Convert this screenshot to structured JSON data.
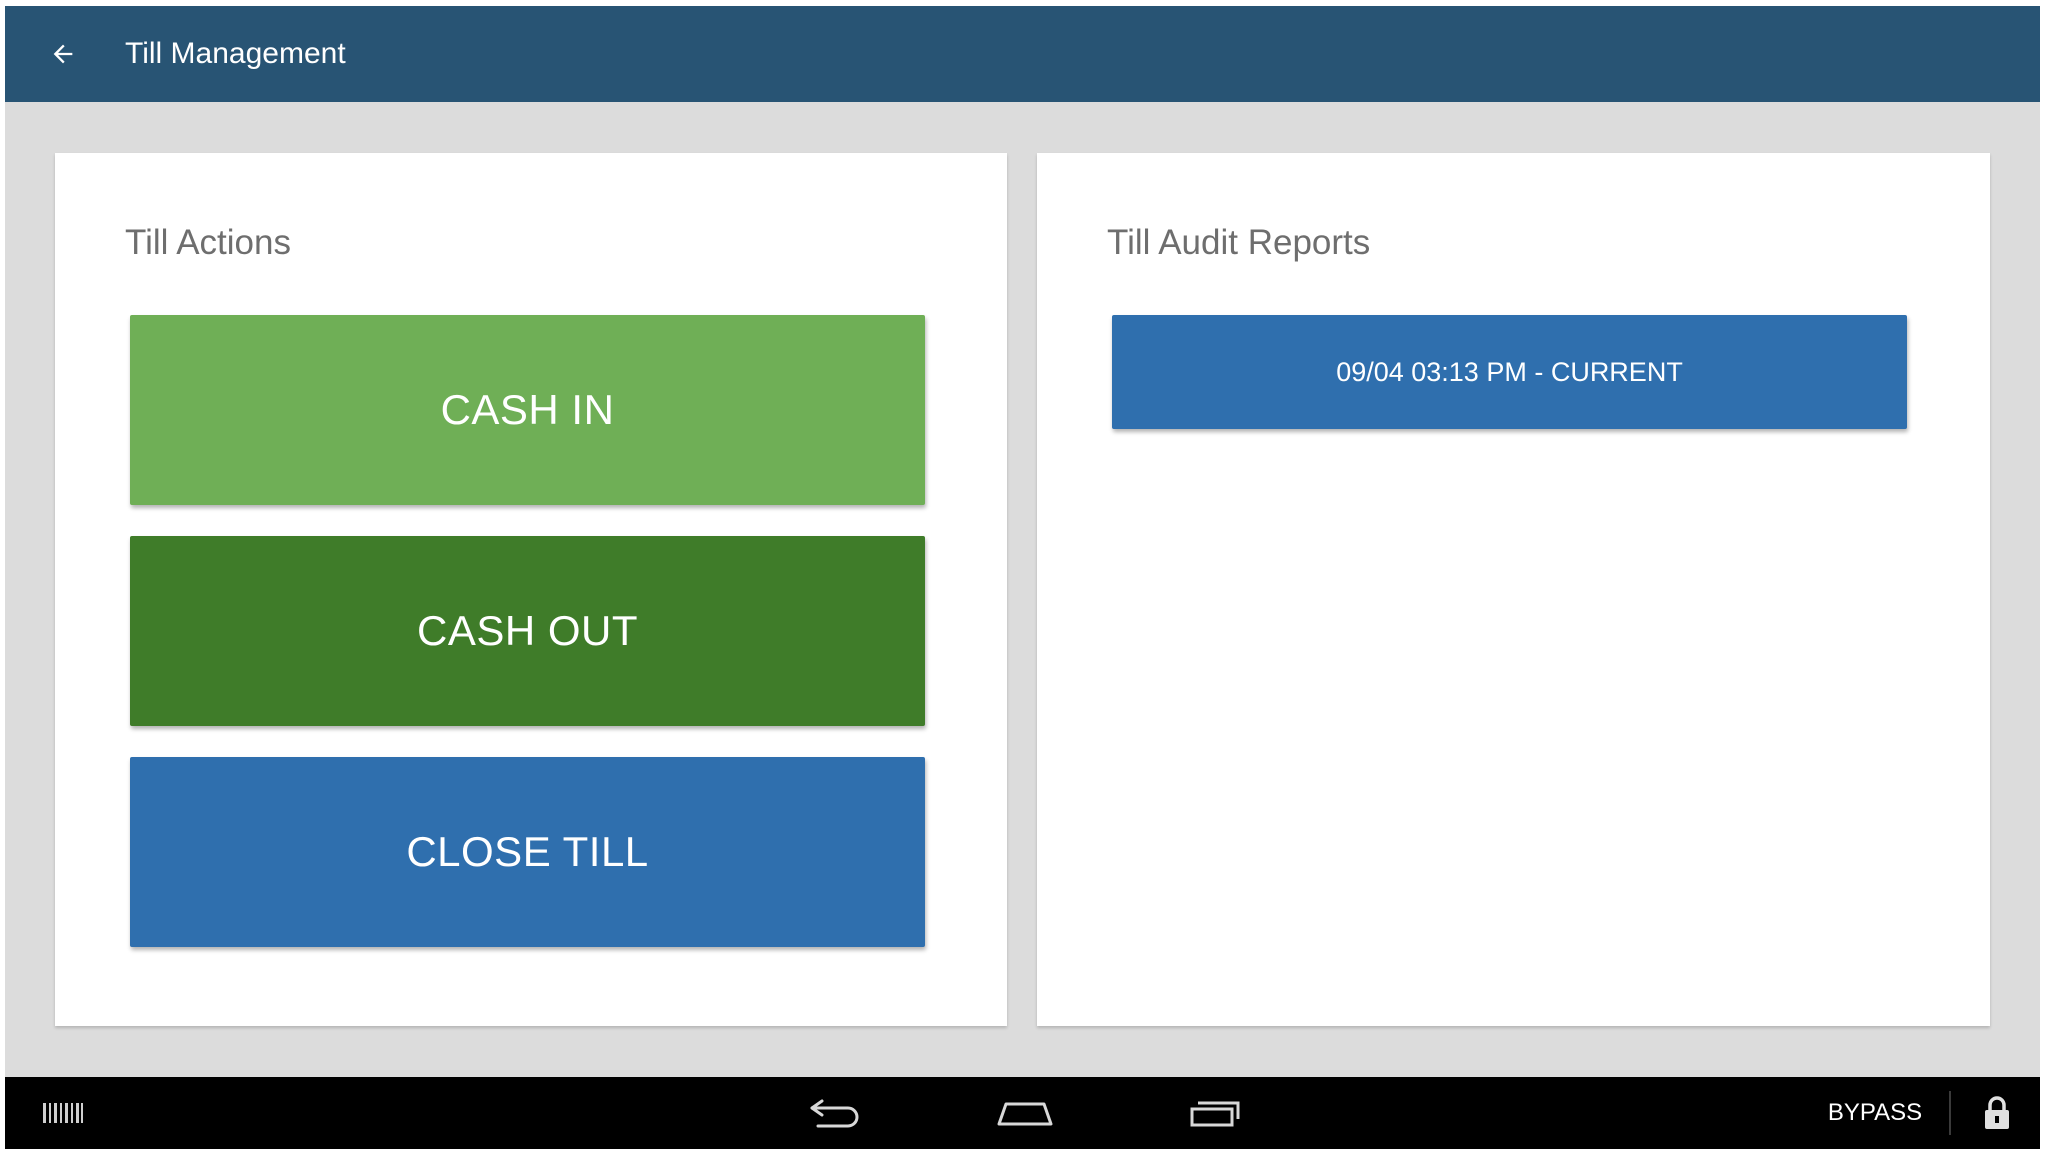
{
  "app_bar": {
    "title": "Till Management",
    "background": "#285474",
    "back_icon": "arrow-left-icon"
  },
  "till_actions": {
    "title": "Till Actions",
    "buttons": [
      {
        "label": "CASH IN",
        "color": "#6faf56"
      },
      {
        "label": "CASH OUT",
        "color": "#3f7c29"
      },
      {
        "label": "CLOSE TILL",
        "color": "#2f6fae"
      }
    ]
  },
  "till_audit_reports": {
    "title": "Till Audit Reports",
    "reports": [
      {
        "label": "09/04 03:13 PM - CURRENT",
        "color": "#2f6fae"
      }
    ]
  },
  "nav_bar": {
    "barcode_icon": "barcode-icon",
    "back_icon": "back-nav-icon",
    "home_icon": "home-nav-icon",
    "recents_icon": "recents-nav-icon",
    "bypass_label": "BYPASS",
    "lock_icon": "lock-icon"
  }
}
